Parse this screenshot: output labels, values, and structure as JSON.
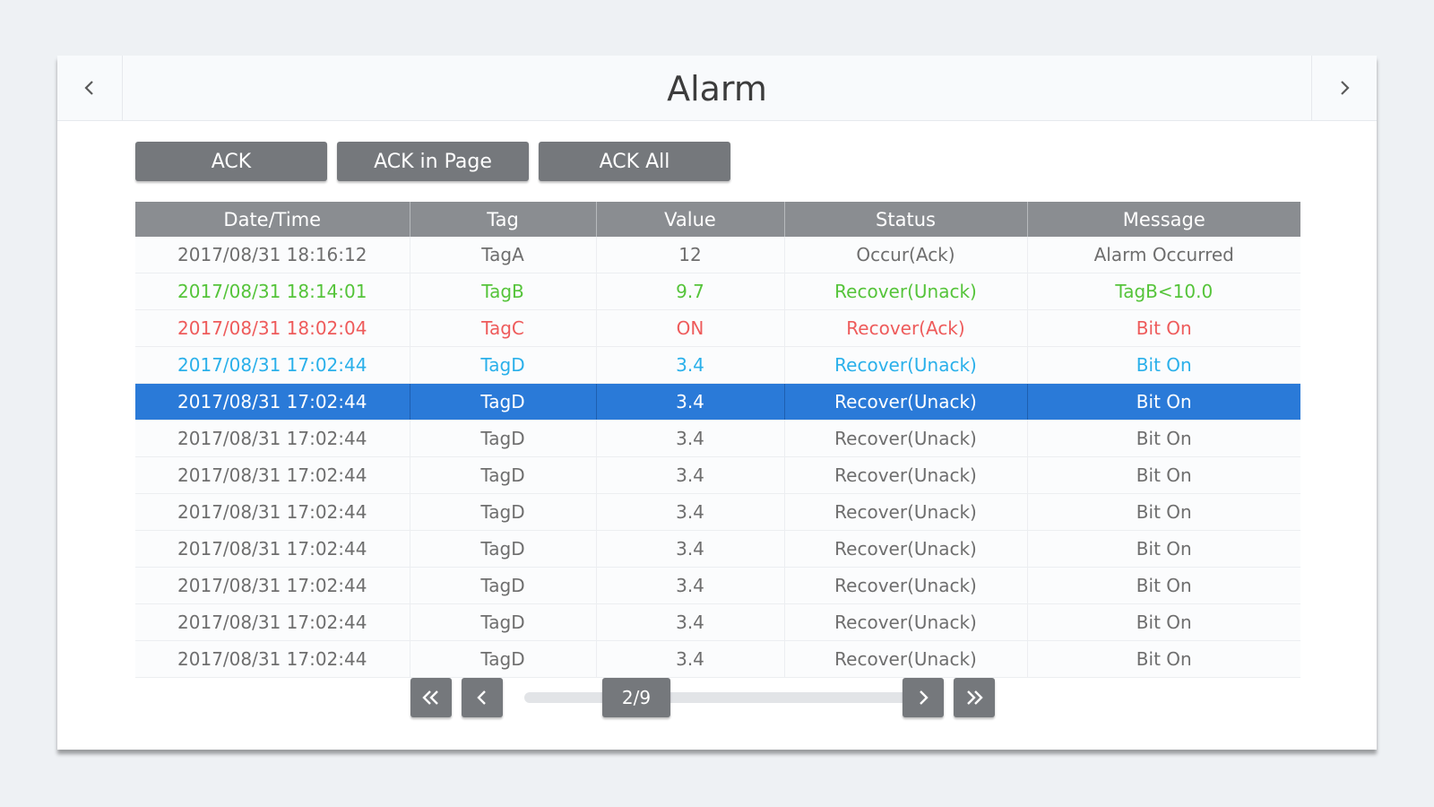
{
  "header": {
    "title": "Alarm"
  },
  "toolbar": {
    "ack_label": "ACK",
    "ack_page_label": "ACK in Page",
    "ack_all_label": "ACK All"
  },
  "table": {
    "columns": [
      "Date/Time",
      "Tag",
      "Value",
      "Status",
      "Message"
    ],
    "rows": [
      {
        "cells": [
          "2017/08/31 18:16:12",
          "TagA",
          "12",
          "Occur(Ack)",
          "Alarm Occurred"
        ],
        "color": "#6e6e6e"
      },
      {
        "cells": [
          "2017/08/31 18:14:01",
          "TagB",
          "9.7",
          "Recover(Unack)",
          "TagB<10.0"
        ],
        "color": "#55c43a"
      },
      {
        "cells": [
          "2017/08/31 18:02:04",
          "TagC",
          "ON",
          "Recover(Ack)",
          "Bit On"
        ],
        "color": "#ee5b5b"
      },
      {
        "cells": [
          "2017/08/31 17:02:44",
          "TagD",
          "3.4",
          "Recover(Unack)",
          "Bit On"
        ],
        "color": "#2ab0ea"
      },
      {
        "cells": [
          "2017/08/31 17:02:44",
          "TagD",
          "3.4",
          "Recover(Unack)",
          "Bit On"
        ],
        "color": "#ffffff",
        "selected": true
      },
      {
        "cells": [
          "2017/08/31 17:02:44",
          "TagD",
          "3.4",
          "Recover(Unack)",
          "Bit On"
        ],
        "color": "#6e6e6e"
      },
      {
        "cells": [
          "2017/08/31 17:02:44",
          "TagD",
          "3.4",
          "Recover(Unack)",
          "Bit On"
        ],
        "color": "#6e6e6e"
      },
      {
        "cells": [
          "2017/08/31 17:02:44",
          "TagD",
          "3.4",
          "Recover(Unack)",
          "Bit On"
        ],
        "color": "#6e6e6e"
      },
      {
        "cells": [
          "2017/08/31 17:02:44",
          "TagD",
          "3.4",
          "Recover(Unack)",
          "Bit On"
        ],
        "color": "#6e6e6e"
      },
      {
        "cells": [
          "2017/08/31 17:02:44",
          "TagD",
          "3.4",
          "Recover(Unack)",
          "Bit On"
        ],
        "color": "#6e6e6e"
      },
      {
        "cells": [
          "2017/08/31 17:02:44",
          "TagD",
          "3.4",
          "Recover(Unack)",
          "Bit On"
        ],
        "color": "#6e6e6e"
      },
      {
        "cells": [
          "2017/08/31 17:02:44",
          "TagD",
          "3.4",
          "Recover(Unack)",
          "Bit On"
        ],
        "color": "#6e6e6e"
      }
    ]
  },
  "pager": {
    "page_label": "2/9",
    "icons": {
      "first": "double-chevron-left-icon",
      "prev": "chevron-left-icon",
      "next": "chevron-right-icon",
      "last": "double-chevron-right-icon"
    }
  },
  "colors": {
    "selected_row": "#2a7ad8",
    "button": "#75787c",
    "header_row": "#8a8d91"
  }
}
